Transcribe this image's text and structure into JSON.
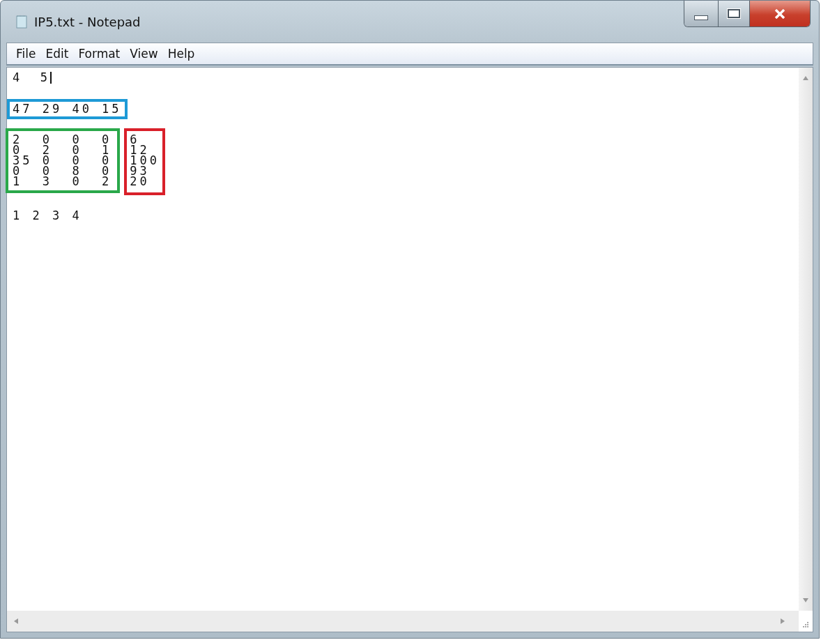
{
  "window": {
    "title": "IP5.txt - Notepad"
  },
  "menu": [
    "File",
    "Edit",
    "Format",
    "View",
    "Help"
  ],
  "document": {
    "first_line": "4  5",
    "cost_line": {
      "text": "47 29 40 15",
      "color": "#1e9ad6"
    },
    "matrix": {
      "color": "#2aa84a",
      "rows": [
        "2  0  0  0",
        "0  2  0  1",
        "35 0  0  0",
        "0  0  8  0",
        "1  3  0  2"
      ]
    },
    "rhs": {
      "color": "#d9202a",
      "rows": [
        "6",
        "12",
        "100",
        "93",
        "20"
      ]
    },
    "last_line": "1 2 3 4"
  }
}
